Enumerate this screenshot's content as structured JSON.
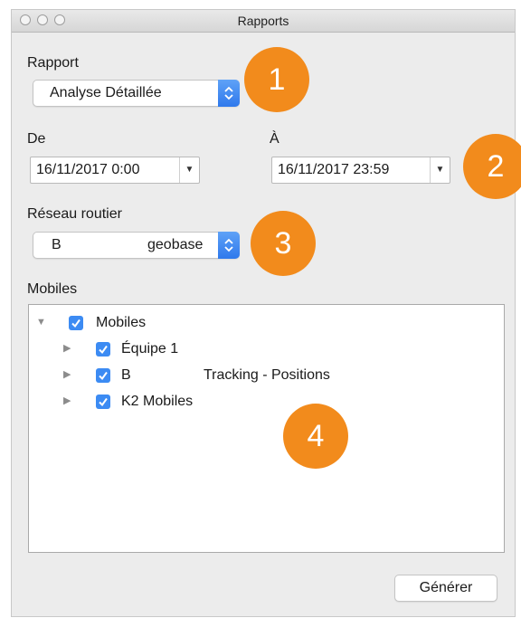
{
  "window": {
    "title": "Rapports"
  },
  "report": {
    "label": "Rapport",
    "selected": "Analyse Détaillée"
  },
  "from": {
    "label": "De",
    "value": "16/11/2017 0:00"
  },
  "to": {
    "label": "À",
    "value": "16/11/2017 23:59"
  },
  "road_network": {
    "label": "Réseau routier",
    "prefix": "B",
    "suffix": "geobase"
  },
  "mobiles": {
    "label": "Mobiles",
    "tree": {
      "root": {
        "label": "Mobiles",
        "checked": true,
        "expanded": true
      },
      "children": [
        {
          "label": "Équipe 1",
          "checked": true
        },
        {
          "prefix": "B",
          "suffix": "Tracking - Positions",
          "checked": true
        },
        {
          "label": "K2 Mobiles",
          "checked": true
        }
      ]
    }
  },
  "generate_button": {
    "label": "Générer"
  },
  "callouts": [
    "1",
    "2",
    "3",
    "4"
  ],
  "colors": {
    "accent": "#3c8bf3",
    "callout": "#f28b1c"
  }
}
